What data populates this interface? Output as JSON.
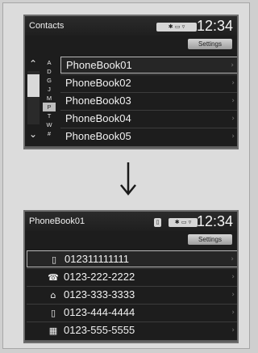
{
  "screen1": {
    "title": "Contacts",
    "status": "✱ ▭ ▿",
    "clock": "12:34",
    "settings_label": "Settings",
    "nav_up": "⌃",
    "nav_down": "⌄",
    "index": [
      "A",
      "D",
      "G",
      "J",
      "M",
      "P",
      "T",
      "W",
      "#"
    ],
    "index_selected": "P",
    "rows": [
      {
        "label": "PhoneBook01"
      },
      {
        "label": "PhoneBook02"
      },
      {
        "label": "PhoneBook03"
      },
      {
        "label": "PhoneBook04"
      },
      {
        "label": "PhoneBook05"
      }
    ],
    "focused_row": 0
  },
  "screen2": {
    "title": "PhoneBook01",
    "phone_badge": "▯",
    "status": "✱ ▭ ▿",
    "clock": "12:34",
    "settings_label": "Settings",
    "rows": [
      {
        "icon": "mobile-phone-icon",
        "glyph": "▯",
        "number": "012311111111"
      },
      {
        "icon": "work-phone-icon",
        "glyph": "☎",
        "number": "0123-222-2222"
      },
      {
        "icon": "home-icon",
        "glyph": "⌂",
        "number": "0123-333-3333"
      },
      {
        "icon": "mobile-phone-icon",
        "glyph": "▯",
        "number": "0123-444-4444"
      },
      {
        "icon": "fax-icon",
        "glyph": "▦",
        "number": "0123-555-5555"
      }
    ],
    "focused_row": 0
  },
  "transition_arrow": "down-arrow-icon"
}
